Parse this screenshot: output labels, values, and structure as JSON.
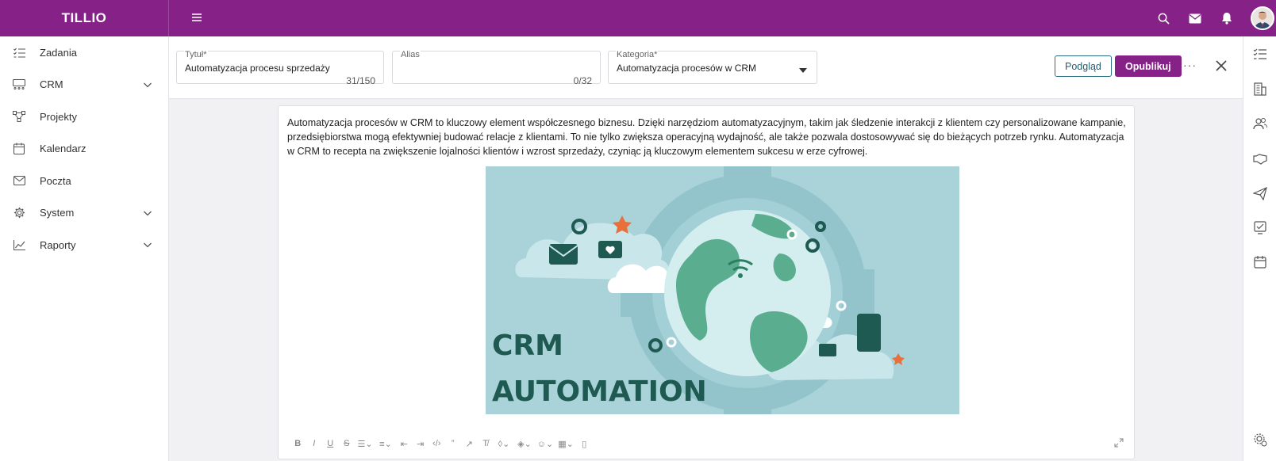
{
  "app": {
    "logo": "TILLIO"
  },
  "topbar": {
    "icons": [
      "search-icon",
      "mail-icon",
      "bell-icon",
      "avatar"
    ]
  },
  "sidebar": {
    "items": [
      {
        "label": "Zadania",
        "icon": "tasks-icon",
        "expandable": false
      },
      {
        "label": "CRM",
        "icon": "crm-icon",
        "expandable": true
      },
      {
        "label": "Projekty",
        "icon": "projects-icon",
        "expandable": false
      },
      {
        "label": "Kalendarz",
        "icon": "calendar-icon",
        "expandable": false
      },
      {
        "label": "Poczta",
        "icon": "mail-icon",
        "expandable": false
      },
      {
        "label": "System",
        "icon": "gear-icon",
        "expandable": true
      },
      {
        "label": "Raporty",
        "icon": "chart-icon",
        "expandable": true
      }
    ]
  },
  "form": {
    "title": {
      "label": "Tytuł*",
      "value": "Automatyzacja procesu sprzedaży",
      "count": "31/150"
    },
    "alias": {
      "label": "Alias",
      "value": "",
      "count": "0/32"
    },
    "category": {
      "label": "Kategoria*",
      "value": "Automatyzacja procesów w CRM"
    },
    "preview_label": "Podgląd",
    "publish_label": "Opublikuj",
    "more_label": "···"
  },
  "editor": {
    "body": "Automatyzacja procesów w CRM to kluczowy element współczesnego biznesu. Dzięki narzędziom automatyzacyjnym, takim jak śledzenie interakcji z klientem czy personalizowane kampanie, przedsiębiorstwa mogą efektywniej budować relacje z klientami. To nie tylko zwiększa operacyjną wydajność, ale także pozwala dostosowywać się do bieżących potrzeb rynku. Automatyzacja w CRM to recepta na zwiększenie lojalności klientów i wzrost sprzedaży, czyniąc ją kluczowym elementem sukcesu w erze cyfrowej.",
    "image": {
      "line1": "CRM",
      "line2": "AUTOMATION"
    },
    "toolbar": [
      "bold-icon",
      "italic-icon",
      "underline-icon",
      "strikethrough-icon",
      "bullet-list-icon",
      "numbered-list-icon",
      "outdent-icon",
      "indent-icon",
      "code-icon",
      "quote-icon",
      "link-icon",
      "clear-format-icon",
      "text-color-icon",
      "highlight-icon",
      "emoji-icon",
      "table-icon",
      "paste-icon"
    ]
  },
  "rail": {
    "icons": [
      "tasks-icon",
      "building-icon",
      "users-icon",
      "handshake-icon",
      "send-icon",
      "checklist-icon",
      "calendar-icon",
      "settings-icon"
    ]
  },
  "colors": {
    "brand": "#862187",
    "preview_border": "#2a6f84",
    "image_bg": "#a9d3d9",
    "image_dark": "#1f5a52"
  }
}
